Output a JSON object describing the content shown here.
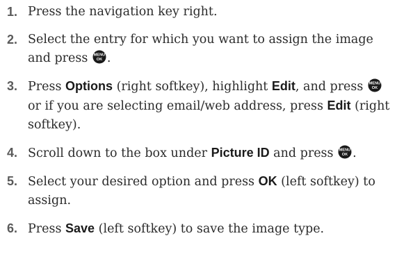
{
  "steps": [
    {
      "number": "1.",
      "parts": [
        "Press the navigation key right."
      ]
    },
    {
      "number": "2.",
      "parts": [
        "Select the entry for which you want to assign the image and press ",
        "."
      ]
    },
    {
      "number": "3.",
      "parts": [
        "Press ",
        "Options",
        " (right softkey), highlight ",
        "Edit",
        ", and press ",
        " or if you are selecting email/web address, press ",
        "Edit",
        " (right softkey)."
      ]
    },
    {
      "number": "4.",
      "parts": [
        "Scroll down to the box under ",
        "Picture ID",
        " and press ",
        "."
      ]
    },
    {
      "number": "5.",
      "parts": [
        "Select your desired option and press ",
        "OK",
        " (left softkey) to assign."
      ]
    },
    {
      "number": "6.",
      "parts": [
        "Press ",
        "Save",
        " (left softkey) to save the image type."
      ]
    }
  ],
  "icon": {
    "name": "menu-ok-icon",
    "top_text": "MENU",
    "bottom_text": "OK",
    "color": "#1a1a1a"
  }
}
